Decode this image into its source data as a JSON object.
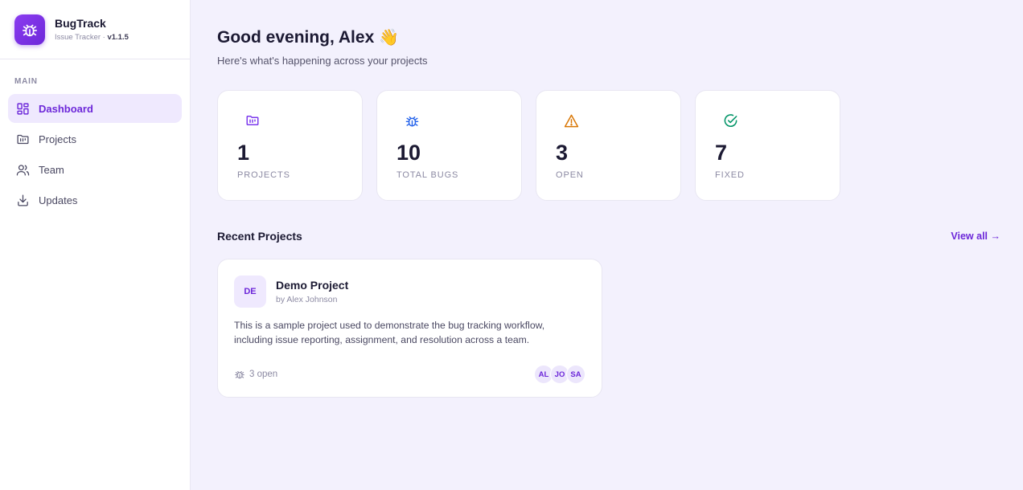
{
  "brand": {
    "name": "BugTrack",
    "subtitle": "Issue Tracker · ",
    "version": "v1.1.5"
  },
  "sidebar": {
    "section": "MAIN",
    "items": [
      {
        "label": "Dashboard",
        "icon": "dashboard-icon",
        "active": true
      },
      {
        "label": "Projects",
        "icon": "folder-icon"
      },
      {
        "label": "Team",
        "icon": "team-icon"
      },
      {
        "label": "Updates",
        "icon": "download-icon"
      }
    ]
  },
  "header": {
    "greeting": "Good evening, Alex",
    "wave": "👋",
    "subtitle": "Here's what's happening across your projects"
  },
  "stats": [
    {
      "value": "1",
      "label": "PROJECTS",
      "icon": "folder-icon",
      "color": "#7c3aed"
    },
    {
      "value": "10",
      "label": "TOTAL BUGS",
      "icon": "bug-icon",
      "color": "#2563eb"
    },
    {
      "value": "3",
      "label": "OPEN",
      "icon": "warning-icon",
      "color": "#d97706"
    },
    {
      "value": "7",
      "label": "FIXED",
      "icon": "check-circle-icon",
      "color": "#059669"
    }
  ],
  "recent": {
    "title": "Recent Projects",
    "view_all": "View all →",
    "project": {
      "initials": "DE",
      "name": "Demo Project",
      "owner": "by Alex Johnson",
      "description": "This is a sample project used to demonstrate the bug tracking workflow, including issue reporting, assignment, and resolution across a team.",
      "open": "3 open",
      "members": [
        "AL",
        "JO",
        "SA"
      ]
    }
  },
  "colors": {
    "accent": "#6d28d9",
    "background": "#f3f1fd"
  }
}
